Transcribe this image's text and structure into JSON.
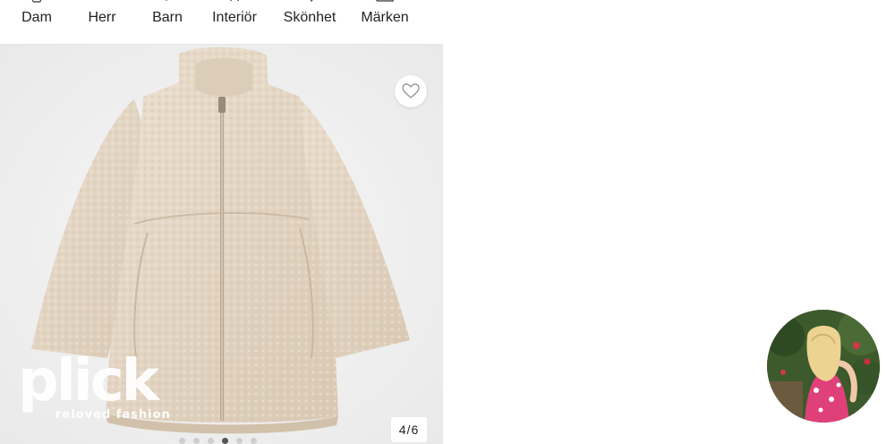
{
  "nav": {
    "items": [
      {
        "label": "Dam",
        "icon": "women-icon"
      },
      {
        "label": "Herr",
        "icon": "men-icon"
      },
      {
        "label": "Barn",
        "icon": "kids-icon"
      },
      {
        "label": "Interiör",
        "icon": "interior-icon"
      },
      {
        "label": "Skönhet",
        "icon": "beauty-icon"
      },
      {
        "label": "Märken",
        "icon": "brands-icon"
      }
    ]
  },
  "product": {
    "image": "beige teddy fleece zip jacket",
    "image_counter": "4/6",
    "carousel_total": 6,
    "carousel_current": 4
  },
  "watermark": {
    "brand": "plick",
    "tagline": "reloved fashion"
  },
  "colors": {
    "background": "#ffffff",
    "image_bg": "#f0f0f0",
    "jacket": "#e3d5c3"
  }
}
